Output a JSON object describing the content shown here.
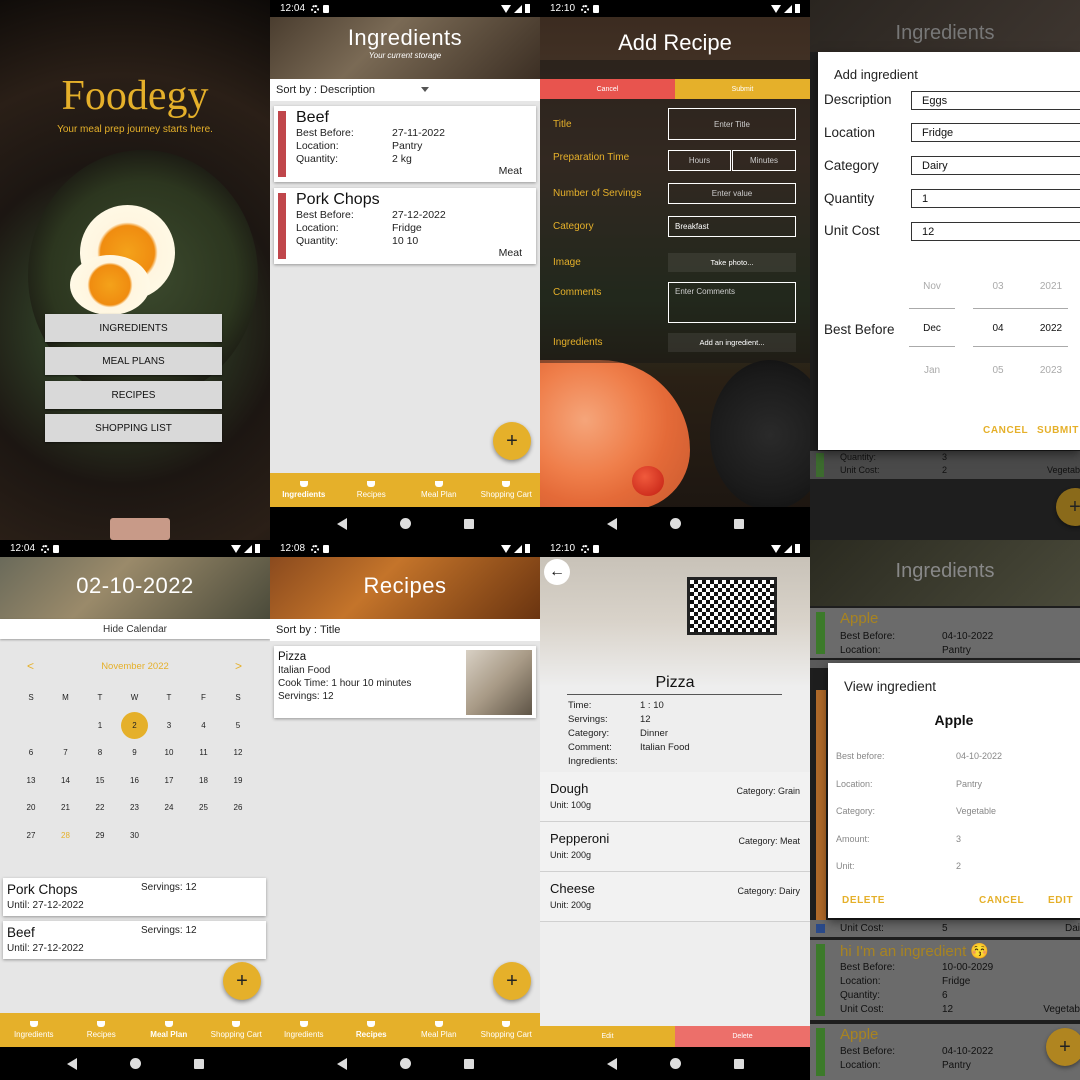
{
  "status_times": {
    "p2": "12:04",
    "p3": "12:10",
    "p5": "12:04",
    "p6": "12:08",
    "p7": "12:10"
  },
  "home": {
    "title": "Foodegy",
    "tagline": "Your meal prep journey starts here.",
    "buttons": [
      "INGREDIENTS",
      "MEAL PLANS",
      "RECIPES",
      "SHOPPING LIST"
    ]
  },
  "bottom_nav": [
    "Ingredients",
    "Recipes",
    "Meal Plan",
    "Shopping Cart"
  ],
  "ingredients_screen": {
    "title": "Ingredients",
    "subtitle": "Your current storage",
    "sort_label": "Sort by :",
    "sort_value": "Description",
    "field_labels": [
      "Best Before:",
      "Location:",
      "Quantity:"
    ],
    "items": [
      {
        "name": "Beef",
        "best_before": "27-11-2022",
        "location": "Pantry",
        "quantity": "2 kg",
        "category": "Meat",
        "color": "#c0464b"
      },
      {
        "name": "Pork Chops",
        "best_before": "27-12-2022",
        "location": "Fridge",
        "quantity": "10 10",
        "category": "Meat",
        "color": "#c0464b"
      }
    ],
    "fab": "+"
  },
  "add_recipe": {
    "title": "Add Recipe",
    "cancel": "Cancel",
    "submit": "Submit",
    "cancel_color": "#e8544e",
    "submit_color": "#e5b02a",
    "labels": [
      "Title",
      "Preparation Time",
      "Number of Servings",
      "Category",
      "Image",
      "Comments",
      "Ingredients"
    ],
    "title_placeholder": "Enter Title",
    "hours_placeholder": "Hours",
    "minutes_placeholder": "Minutes",
    "servings_placeholder": "Enter value",
    "category_value": "Breakfast",
    "take_photo": "Take photo...",
    "comments_placeholder": "Enter Comments",
    "add_ingredient": "Add an ingredient..."
  },
  "add_ingredient_dialog": {
    "bg_title": "Ingredients",
    "title": "Add ingredient",
    "fields": [
      {
        "label": "Description",
        "value": "Eggs"
      },
      {
        "label": "Location",
        "value": "Fridge"
      },
      {
        "label": "Category",
        "value": "Dairy"
      },
      {
        "label": "Quantity",
        "value": "1"
      },
      {
        "label": "Unit Cost",
        "value": "12"
      }
    ],
    "best_before_label": "Best Before",
    "picker": {
      "months": [
        "Nov",
        "Dec",
        "Jan"
      ],
      "days": [
        "03",
        "04",
        "05"
      ],
      "years": [
        "2021",
        "2022",
        "2023"
      ]
    },
    "cancel": "CANCEL",
    "submit": "SUBMIT",
    "behind_rows": [
      {
        "label": "Quantity:",
        "value": "3",
        "cat": ""
      },
      {
        "label": "Unit Cost:",
        "value": "2",
        "cat": "Vegetab"
      }
    ],
    "fab": "+"
  },
  "meal_plan": {
    "date": "02-10-2022",
    "hide_calendar": "Hide Calendar",
    "month": "November 2022",
    "prev": "<",
    "next": ">",
    "weekdays": [
      "S",
      "M",
      "T",
      "W",
      "T",
      "F",
      "S"
    ],
    "weeks": [
      [
        "",
        "",
        "1",
        "2",
        "3",
        "4",
        "5"
      ],
      [
        "6",
        "7",
        "8",
        "9",
        "10",
        "11",
        "12"
      ],
      [
        "13",
        "14",
        "15",
        "16",
        "17",
        "18",
        "19"
      ],
      [
        "20",
        "21",
        "22",
        "23",
        "24",
        "25",
        "26"
      ],
      [
        "27",
        "28",
        "29",
        "30",
        "",
        "",
        ""
      ]
    ],
    "selected_day": "2",
    "today_day": "28",
    "meals": [
      {
        "name": "Pork Chops",
        "until": "Until: 27-12-2022",
        "servings": "Servings: 12"
      },
      {
        "name": "Beef",
        "until": "Until: 27-12-2022",
        "servings": "Servings: 12"
      }
    ],
    "fab": "+"
  },
  "recipes": {
    "title": "Recipes",
    "sort_label": "Sort by :",
    "sort_value": "Title",
    "items": [
      {
        "name": "Pizza",
        "category": "Italian Food",
        "cook_time": "Cook Time: 1 hour 10 minutes",
        "servings": "Servings: 12"
      }
    ],
    "fab": "+"
  },
  "recipe_detail": {
    "back": "←",
    "title": "Pizza",
    "labels": [
      "Time:",
      "Servings:",
      "Category:",
      "Comment:",
      "Ingredients:"
    ],
    "values": [
      "1 : 10",
      "12",
      "Dinner",
      "Italian Food",
      ""
    ],
    "ingredients": [
      {
        "name": "Dough",
        "unit": "Unit: 100g",
        "category": "Category: Grain"
      },
      {
        "name": "Pepperoni",
        "unit": "Unit: 200g",
        "category": "Category: Meat"
      },
      {
        "name": "Cheese",
        "unit": "Unit: 200g",
        "category": "Category: Dairy"
      }
    ],
    "edit": "Edit",
    "delete": "Delete",
    "edit_color": "#e5b02a",
    "delete_color": "#ec6f6a"
  },
  "view_ingredient": {
    "bg_title": "Ingredients",
    "title": "View ingredient",
    "name": "Apple",
    "labels": [
      "Best before:",
      "Location:",
      "Category:",
      "Amount:",
      "Unit:"
    ],
    "values": [
      "04-10-2022",
      "Pantry",
      "Vegetable",
      "3",
      "2"
    ],
    "delete": "DELETE",
    "cancel": "CANCEL",
    "edit": "EDIT",
    "bg_items": [
      {
        "name": "Apple",
        "best_before": "04-10-2022",
        "location": "Pantry",
        "color": "#4fa03a"
      },
      {
        "name": "hi I'm an ingredient 😚",
        "best_before": "10-00-2029",
        "location": "Fridge",
        "quantity": "6",
        "unit_cost": "12",
        "cat": "Vegetab",
        "color": "#4fa03a"
      },
      {
        "name": "Apple",
        "best_before": "04-10-2022",
        "location": "Pantry",
        "color": "#4fa03a"
      }
    ],
    "bg_labels": [
      "Best Before:",
      "Location:",
      "Quantity:",
      "Unit Cost:"
    ],
    "bg_partial": {
      "unit_cost_label": "Unit Cost:",
      "unit_cost": "5",
      "cat": "Dai"
    },
    "fab": "+"
  }
}
